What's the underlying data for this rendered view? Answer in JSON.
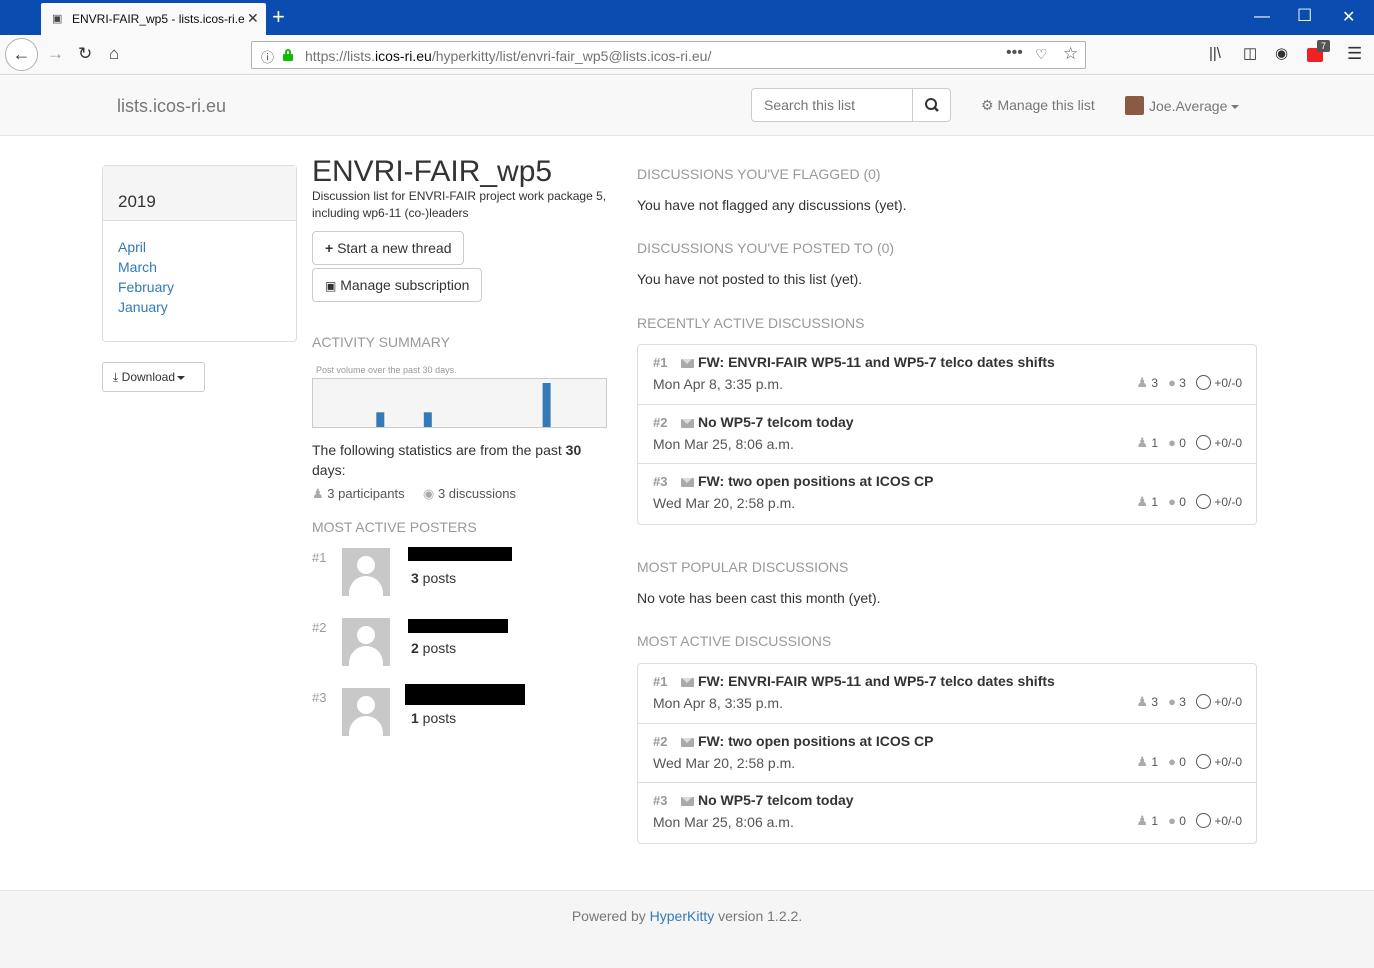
{
  "browser": {
    "tab_title": "ENVRI-FAIR_wp5 - lists.icos-ri.e",
    "url_prefix": "https://lists.",
    "url_domain": "icos-ri.eu",
    "url_path": "/hyperkitty/list/envri-fair_wp5@lists.icos-ri.eu/",
    "addon_badge": "7"
  },
  "header": {
    "brand": "lists.icos-ri.eu",
    "search_placeholder": "Search this list",
    "manage_label": "Manage this list",
    "user_name": "Joe.Average"
  },
  "sidebar": {
    "year": "2019",
    "months": [
      "April",
      "March",
      "February",
      "January"
    ],
    "download_label": "Download"
  },
  "list": {
    "name": "ENVRI-FAIR_wp5",
    "description": "Discussion list for ENVRI-FAIR project work package 5, including wp6-11 (co-)leaders",
    "new_thread_label": "Start a new thread",
    "subscription_label": "Manage subscription"
  },
  "activity": {
    "heading": "ACTIVITY SUMMARY",
    "chart_caption": "Post volume over the past 30 days.",
    "stats_prefix": "The following statistics are from the past ",
    "stats_days": "30",
    "stats_suffix": " days:",
    "participants": "3 participants",
    "discussions": "3 discussions"
  },
  "chart_data": {
    "type": "bar",
    "title": "Post volume over the past 30 days.",
    "values": [
      0,
      0,
      0,
      0,
      0,
      0,
      0,
      0,
      1,
      0,
      0,
      0,
      0,
      0,
      1,
      0,
      0,
      0,
      0,
      0,
      0,
      0,
      0,
      0,
      0,
      0,
      0,
      0,
      0,
      3,
      0,
      0,
      0,
      0,
      0,
      0,
      0
    ],
    "color": "#337ab7"
  },
  "posters": {
    "heading": "MOST ACTIVE POSTERS",
    "items": [
      {
        "rank": "#1",
        "count": "3",
        "unit": " posts"
      },
      {
        "rank": "#2",
        "count": "2",
        "unit": " posts"
      },
      {
        "rank": "#3",
        "count": "1",
        "unit": " posts"
      }
    ]
  },
  "flagged": {
    "heading": "DISCUSSIONS YOU'VE FLAGGED (0)",
    "text": "You have not flagged any discussions (yet)."
  },
  "posted": {
    "heading": "DISCUSSIONS YOU'VE POSTED TO (0)",
    "text": "You have not posted to this list (yet)."
  },
  "recent": {
    "heading": "RECENTLY ACTIVE DISCUSSIONS",
    "threads": [
      {
        "rank": "#1",
        "subject": "FW: ENVRI-FAIR WP5-11 and WP5-7 telco dates shifts",
        "date": "Mon Apr 8, 3:35 p.m.",
        "participants": "3",
        "replies": "3",
        "votes": "+0/-0"
      },
      {
        "rank": "#2",
        "subject": "No WP5-7 telcom today",
        "date": "Mon Mar 25, 8:06 a.m.",
        "participants": "1",
        "replies": "0",
        "votes": "+0/-0"
      },
      {
        "rank": "#3",
        "subject": "FW: two open positions at ICOS CP",
        "date": "Wed Mar 20, 2:58 p.m.",
        "participants": "1",
        "replies": "0",
        "votes": "+0/-0"
      }
    ]
  },
  "popular": {
    "heading": "MOST POPULAR DISCUSSIONS",
    "text": "No vote has been cast this month (yet)."
  },
  "active": {
    "heading": "MOST ACTIVE DISCUSSIONS",
    "threads": [
      {
        "rank": "#1",
        "subject": "FW: ENVRI-FAIR WP5-11 and WP5-7 telco dates shifts",
        "date": "Mon Apr 8, 3:35 p.m.",
        "participants": "3",
        "replies": "3",
        "votes": "+0/-0"
      },
      {
        "rank": "#2",
        "subject": "FW: two open positions at ICOS CP",
        "date": "Wed Mar 20, 2:58 p.m.",
        "participants": "1",
        "replies": "0",
        "votes": "+0/-0"
      },
      {
        "rank": "#3",
        "subject": "No WP5-7 telcom today",
        "date": "Mon Mar 25, 8:06 a.m.",
        "participants": "1",
        "replies": "0",
        "votes": "+0/-0"
      }
    ]
  },
  "footer": {
    "prefix": "Powered by ",
    "link": "HyperKitty",
    "suffix": " version 1.2.2."
  }
}
